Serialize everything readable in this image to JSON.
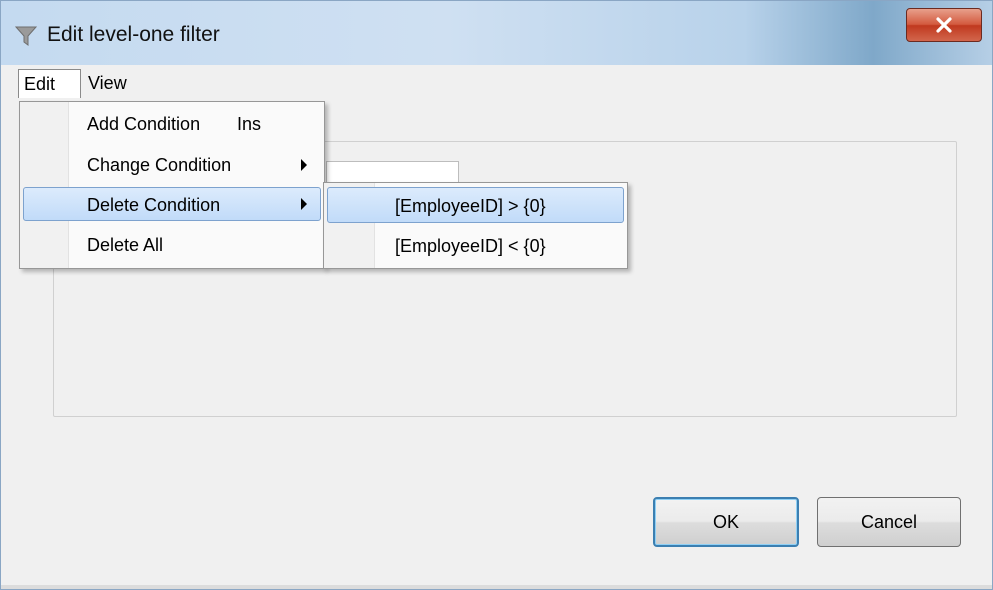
{
  "window": {
    "title": "Edit level-one filter",
    "icon": "filter-funnel-icon",
    "close_icon": "close-x-icon"
  },
  "menubar": {
    "items": [
      {
        "label": "Edit",
        "active": true
      },
      {
        "label": "View",
        "active": false
      }
    ]
  },
  "edit_menu": {
    "items": [
      {
        "label": "Add Condition",
        "shortcut": "Ins",
        "has_submenu": false,
        "highlighted": false
      },
      {
        "label": "Change Condition",
        "shortcut": "",
        "has_submenu": true,
        "highlighted": false
      },
      {
        "label": "Delete Condition",
        "shortcut": "",
        "has_submenu": true,
        "highlighted": true
      },
      {
        "label": "Delete All",
        "shortcut": "",
        "has_submenu": false,
        "highlighted": false
      }
    ]
  },
  "delete_submenu": {
    "items": [
      {
        "label": "[EmployeeID] > {0}",
        "highlighted": true
      },
      {
        "label": "[EmployeeID] < {0}",
        "highlighted": false
      }
    ]
  },
  "buttons": {
    "ok_label": "OK",
    "cancel_label": "Cancel"
  },
  "colors": {
    "highlight": "#c1dbf9",
    "close_button": "#c0391f",
    "default_button_border": "#3c7fb1"
  }
}
